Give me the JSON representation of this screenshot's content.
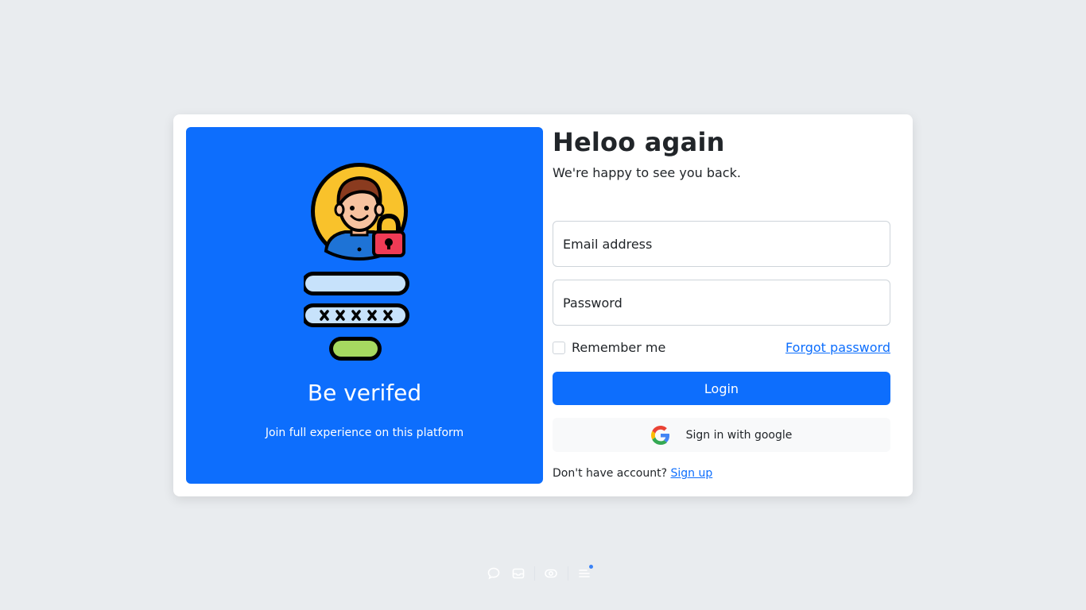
{
  "left_panel": {
    "title": "Be verifed",
    "subtitle": "Join full experience on this platform",
    "illustration_icon": "user-lock-login-icon",
    "background_color": "#0d6efd"
  },
  "right_panel": {
    "heading": "Heloo again",
    "subheading": "We're happy to see you back.",
    "email_placeholder": "Email address",
    "password_placeholder": "Password",
    "remember_label": "Remember me",
    "forgot_label": "Forgot password",
    "login_label": "Login",
    "google_label": "Sign in with google",
    "signup_prompt": "Don't have account?",
    "signup_link": "Sign up"
  },
  "bottom_toolbar": {
    "icons": [
      "chat-icon",
      "inbox-icon",
      "eye-icon",
      "menu-icon"
    ],
    "has_notification_dot": true
  },
  "colors": {
    "accent": "#0d6efd",
    "page_background": "#e9ecef"
  }
}
